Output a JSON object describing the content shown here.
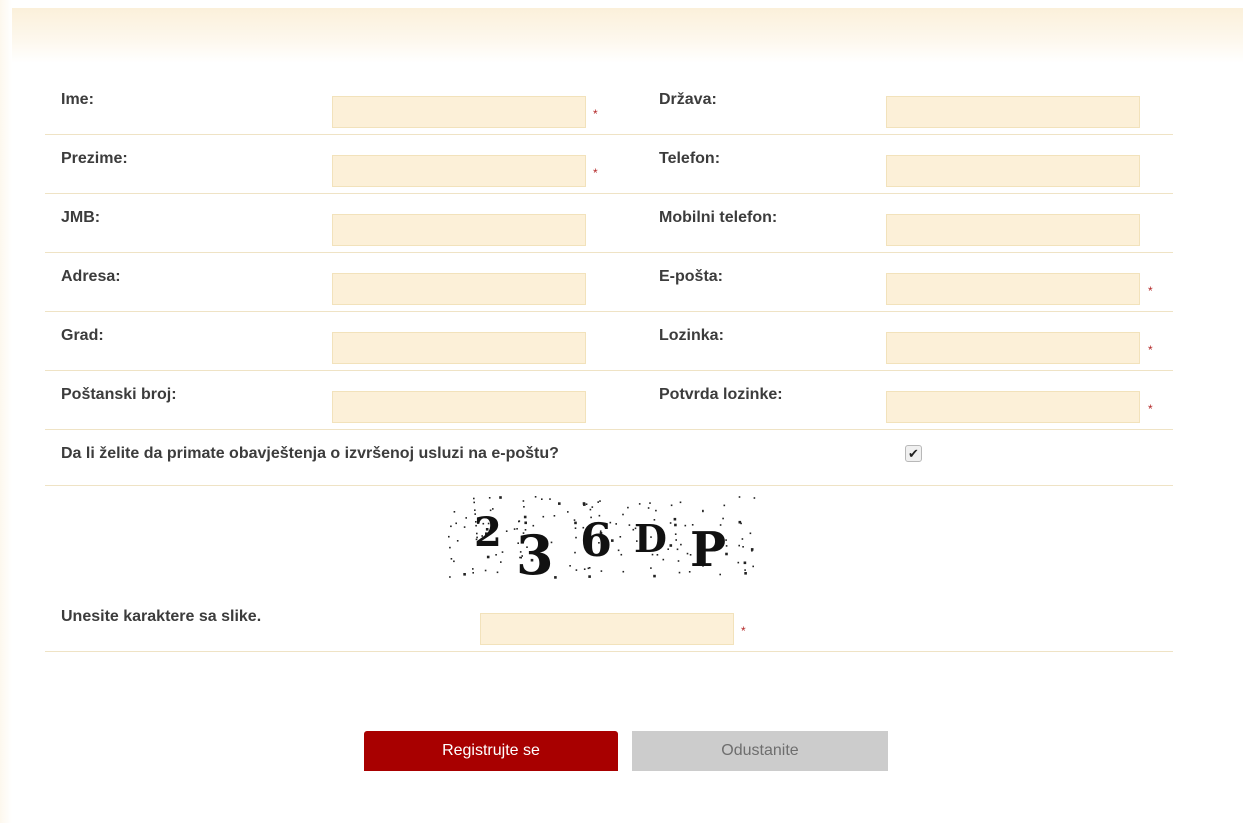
{
  "form": {
    "fields": [
      {
        "left_label": "Ime:",
        "left_required": true,
        "right_label": "Država:",
        "right_required": false
      },
      {
        "left_label": "Prezime:",
        "left_required": true,
        "right_label": "Telefon:",
        "right_required": false
      },
      {
        "left_label": "JMB:",
        "left_required": false,
        "right_label": "Mobilni telefon:",
        "right_required": false
      },
      {
        "left_label": "Adresa:",
        "left_required": false,
        "right_label": "E-pošta:",
        "right_required": true
      },
      {
        "left_label": "Grad:",
        "left_required": false,
        "right_label": "Lozinka:",
        "right_required": true
      },
      {
        "left_label": "Poštanski broj:",
        "left_required": false,
        "right_label": "Potvrda lozinke:",
        "right_required": true
      }
    ],
    "required_mark": "*",
    "notifications_question": "Da li želite da primate obavještenja o izvršenoj usluzi na e-poštu?",
    "notifications_checked": true,
    "check_glyph": "✔",
    "captcha_text": "236DP",
    "captcha_label": "Unesite karaktere sa slike.",
    "captcha_required": true
  },
  "buttons": {
    "register_label": "Registrujte se",
    "cancel_label": "Odustanite"
  },
  "colors": {
    "accent": "#a80000",
    "input_bg": "#fcf0d8",
    "required": "#b32727"
  }
}
